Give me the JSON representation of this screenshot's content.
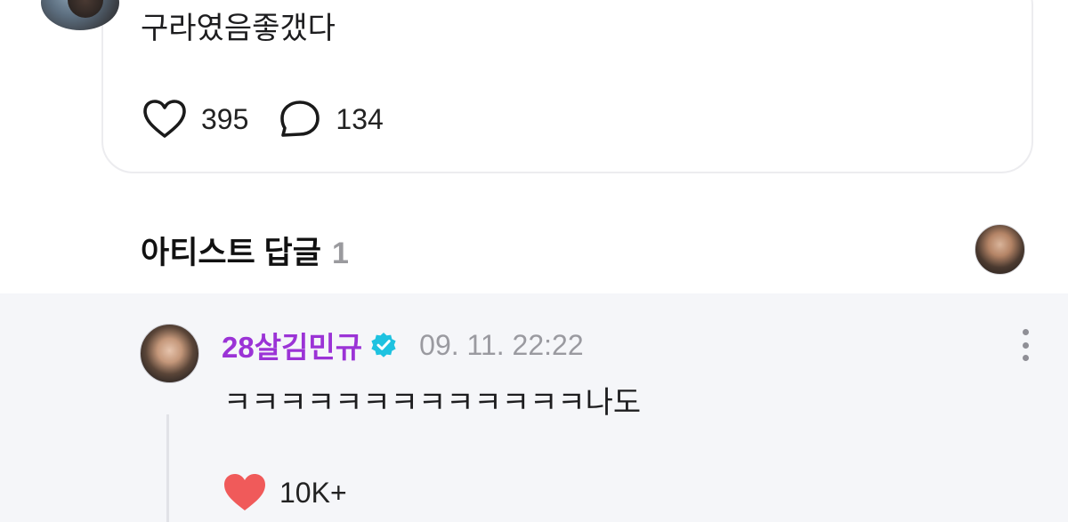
{
  "post": {
    "text": "구라였음좋갰다",
    "like_count": "395",
    "comment_count": "134",
    "icons": {
      "like": "heart-outline-icon",
      "comment": "comment-bubble-icon"
    }
  },
  "artist_replies": {
    "title": "아티스트 답글",
    "count": "1"
  },
  "reply": {
    "author": "28살김민규",
    "verified": true,
    "timestamp": "09. 11. 22:22",
    "text": "ㅋㅋㅋㅋㅋㅋㅋㅋㅋㅋㅋㅋㅋ나도",
    "like_count": "10K+",
    "liked": true,
    "icons": {
      "like": "heart-filled-icon",
      "menu": "more-vertical-icon",
      "badge": "verified-badge-icon"
    }
  },
  "colors": {
    "author_name": "#9b33d6",
    "verified_badge": "#1ec2e0",
    "liked_heart": "#f05a5a",
    "reply_background": "#f5f6f9",
    "muted_text": "#9a9aa0"
  }
}
